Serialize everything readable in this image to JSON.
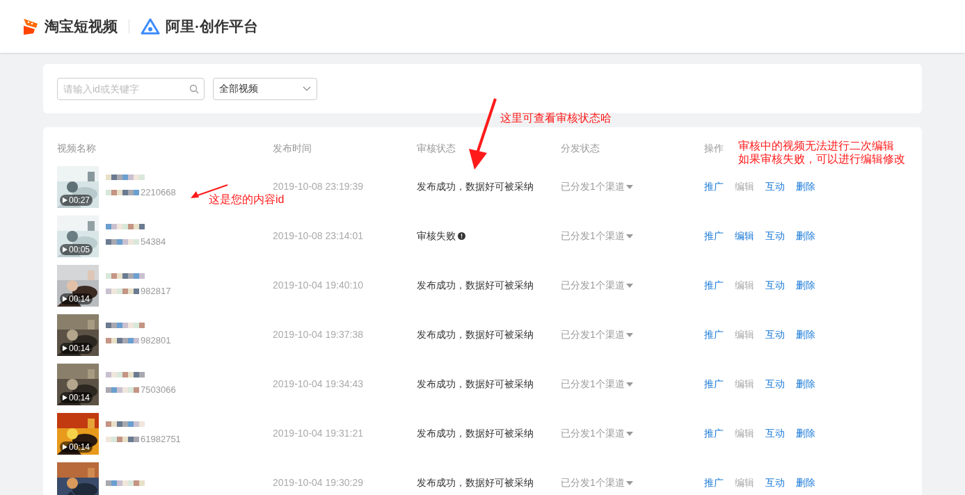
{
  "header": {
    "brand": "淘宝短视频",
    "platform": "阿里·创作平台"
  },
  "filter": {
    "search": {
      "placeholder": "请输入id或关键字"
    },
    "dropdown": {
      "value": "全部视频"
    }
  },
  "table": {
    "columns": [
      "视频名称",
      "发布时间",
      "审核状态",
      "分发状态",
      "操作"
    ],
    "rows": [
      {
        "duration": "00:27",
        "id_tail": "2210668",
        "time": "2019-10-08 23:19:39",
        "status": {
          "kind": "success",
          "text": "发布成功，数据好可被采纳"
        },
        "distribution": "已分发1个渠道",
        "actions": [
          {
            "label": "推广",
            "disabled": false
          },
          {
            "label": "编辑",
            "disabled": true
          },
          {
            "label": "互动",
            "disabled": false
          },
          {
            "label": "删除",
            "disabled": false
          }
        ]
      },
      {
        "duration": "00:05",
        "id_tail": "54384",
        "time": "2019-10-08 23:14:01",
        "status": {
          "kind": "failed",
          "text": "审核失败"
        },
        "distribution": "已分发1个渠道",
        "actions": [
          {
            "label": "推广",
            "disabled": false
          },
          {
            "label": "编辑",
            "disabled": false
          },
          {
            "label": "互动",
            "disabled": false
          },
          {
            "label": "删除",
            "disabled": false
          }
        ]
      },
      {
        "duration": "00:14",
        "id_tail": "982817",
        "time": "2019-10-04 19:40:10",
        "status": {
          "kind": "success",
          "text": "发布成功，数据好可被采纳"
        },
        "distribution": "已分发1个渠道",
        "actions": [
          {
            "label": "推广",
            "disabled": false
          },
          {
            "label": "编辑",
            "disabled": true
          },
          {
            "label": "互动",
            "disabled": false
          },
          {
            "label": "删除",
            "disabled": false
          }
        ]
      },
      {
        "duration": "00:14",
        "id_tail": "982801",
        "time": "2019-10-04 19:37:38",
        "status": {
          "kind": "success",
          "text": "发布成功，数据好可被采纳"
        },
        "distribution": "已分发1个渠道",
        "actions": [
          {
            "label": "推广",
            "disabled": false
          },
          {
            "label": "编辑",
            "disabled": true
          },
          {
            "label": "互动",
            "disabled": false
          },
          {
            "label": "删除",
            "disabled": false
          }
        ]
      },
      {
        "duration": "00:14",
        "id_tail": "7503066",
        "time": "2019-10-04 19:34:43",
        "status": {
          "kind": "success",
          "text": "发布成功，数据好可被采纳"
        },
        "distribution": "已分发1个渠道",
        "actions": [
          {
            "label": "推广",
            "disabled": false
          },
          {
            "label": "编辑",
            "disabled": true
          },
          {
            "label": "互动",
            "disabled": false
          },
          {
            "label": "删除",
            "disabled": false
          }
        ]
      },
      {
        "duration": "00:14",
        "id_tail": "61982751",
        "time": "2019-10-04 19:31:21",
        "status": {
          "kind": "success",
          "text": "发布成功，数据好可被采纳"
        },
        "distribution": "已分发1个渠道",
        "actions": [
          {
            "label": "推广",
            "disabled": false
          },
          {
            "label": "编辑",
            "disabled": true
          },
          {
            "label": "互动",
            "disabled": false
          },
          {
            "label": "删除",
            "disabled": false
          }
        ]
      },
      {
        "time": "2019-10-04 19:30:29",
        "status": {
          "kind": "success",
          "text": "发布成功，数据好可被采纳"
        },
        "distribution": "已分发1个渠道",
        "actions": [
          {
            "label": "推广",
            "disabled": false
          },
          {
            "label": "编辑",
            "disabled": true
          },
          {
            "label": "互动",
            "disabled": false
          },
          {
            "label": "删除",
            "disabled": false
          }
        ]
      }
    ]
  },
  "annotations": [
    "这里可查看审核状态哈",
    "审核中的视频无法进行二次编辑",
    "如果审核失败，可以进行编辑修改",
    "这是您的内容id"
  ]
}
